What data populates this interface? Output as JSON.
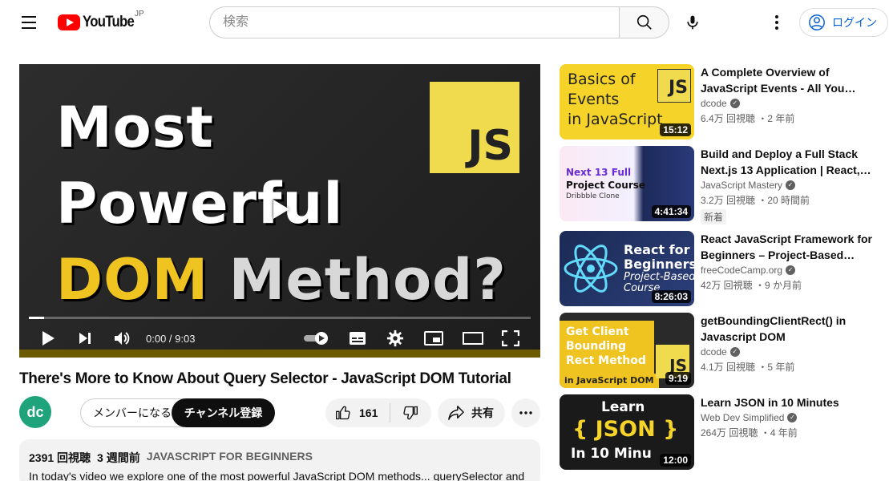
{
  "header": {
    "brand": "YouTube",
    "country": "JP",
    "search_placeholder": "検索",
    "login_label": "ログイン"
  },
  "player": {
    "thumbnail_lines": [
      "Most",
      "Powerful",
      "DOM",
      "Method?"
    ],
    "badge_text": "JS",
    "time_label": "0:00 / 9:03",
    "progress_fraction": 0.03
  },
  "video": {
    "title": "There's More to Know About Query Selector - JavaScript DOM Tutorial",
    "channel_avatar_text": "dc",
    "member_label": "メンバーになる",
    "subscribe_label": "チャンネル登録",
    "like_count": "161",
    "share_label": "共有",
    "views": "2391 回視聴",
    "age": "3 週間前",
    "hashtag": "JAVASCRIPT FOR BEGINNERS",
    "description": "In today's video we explore one of the most powerful JavaScript DOM methods... querySelector and"
  },
  "sidebar": {
    "items": [
      {
        "title": "A Complete Overview of JavaScript Events - All You…",
        "channel": "dcode",
        "meta": "6.4万 回視聴 ・2 年前",
        "duration": "15:12",
        "thumb_text": [
          "Basics of",
          "Events",
          "in JavaScript"
        ],
        "badge": "JS"
      },
      {
        "title": "Build and Deploy a Full Stack Next.js 13 Application | React,…",
        "channel": "JavaScript Mastery",
        "meta": "3.2万 回視聴 ・20 時間前",
        "duration": "4:41:34",
        "new_label": "新着",
        "thumb_text": [
          "Next 13 Full",
          "Project Course",
          "Dribbble Clone"
        ]
      },
      {
        "title": "React JavaScript Framework for Beginners – Project-Based…",
        "channel": "freeCodeCamp.org",
        "meta": "42万 回視聴 ・9 か月前",
        "duration": "8:26:03",
        "thumb_text": [
          "React for",
          "Beginners",
          "Project-Based",
          "Course"
        ]
      },
      {
        "title": "getBoundingClientRect() in Javascript DOM",
        "channel": "dcode",
        "meta": "4.1万 回視聴 ・5 年前",
        "duration": "9:19",
        "thumb_text": [
          "Get Client",
          "Bounding",
          "Rect Method",
          "in JavaScript DOM"
        ],
        "badge": "JS"
      },
      {
        "title": "Learn JSON in 10 Minutes",
        "channel": "Web Dev Simplified",
        "meta": "264万 回視聴 ・4 年前",
        "duration": "12:00",
        "thumb_text": [
          "Learn",
          "{ JSON }",
          "In 10 Minu"
        ]
      }
    ]
  },
  "colors": {
    "brand_red": "#ff0000",
    "link_blue": "#065fd4",
    "js_yellow": "#f0db4f",
    "dom_gold": "#f0c420"
  }
}
